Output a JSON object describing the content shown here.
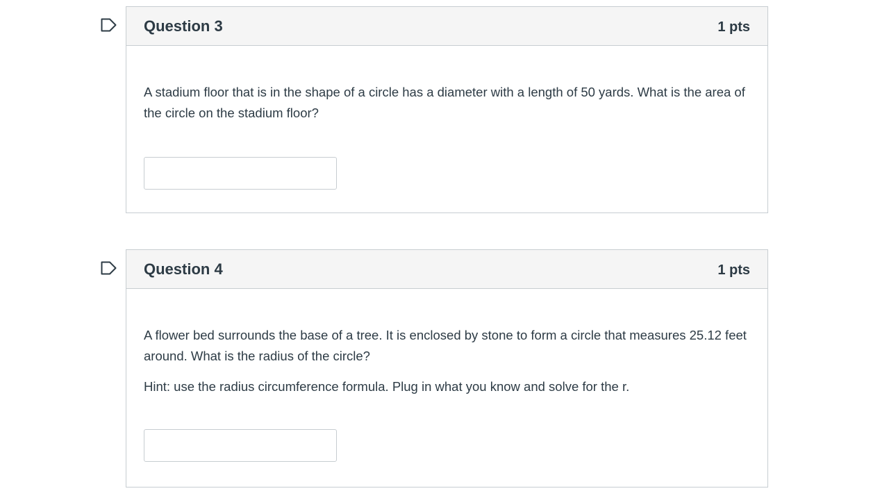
{
  "questions": [
    {
      "title": "Question 3",
      "points": "1 pts",
      "text": "A stadium floor that is in the shape of a circle has a diameter with a length of 50 yards. What is the area of the circle on the stadium floor?",
      "hint": "",
      "answer_value": "",
      "flag_icon": "flag-outline-icon"
    },
    {
      "title": "Question 4",
      "points": "1 pts",
      "text": "A flower bed surrounds the base of a tree. It is enclosed by stone to form a circle that measures 25.12 feet around. What is the radius of the circle?",
      "hint": "Hint: use the radius circumference formula. Plug in what you know and solve for the r.",
      "answer_value": "",
      "flag_icon": "flag-outline-icon"
    }
  ],
  "colors": {
    "text": "#2d3b45",
    "border": "#c7cdd1",
    "header_bg": "#f5f5f5",
    "flag": "#2d3b45"
  }
}
